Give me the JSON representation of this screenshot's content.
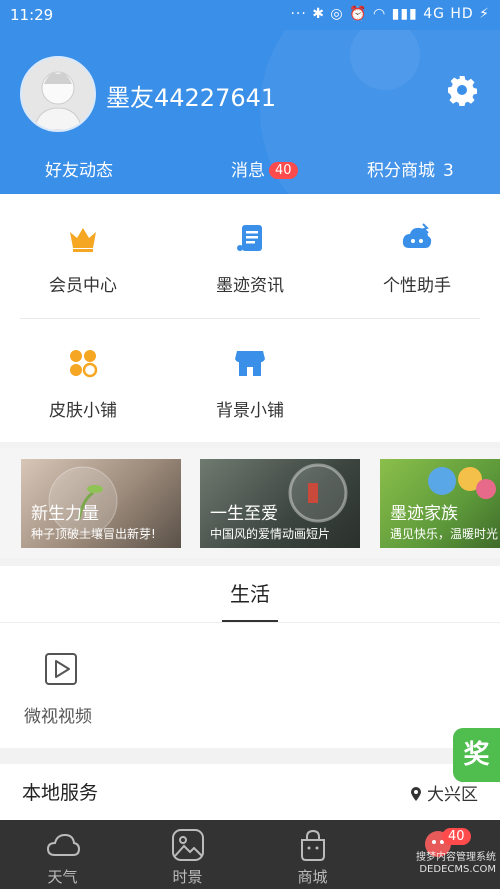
{
  "status": {
    "time": "11:29",
    "icons_text": "··· ✱ ◎ ⏰ ◠ ▮▮▮ 4G HD ⚡"
  },
  "profile": {
    "username": "墨友44227641"
  },
  "header_links": [
    {
      "label": "好友动态"
    },
    {
      "label": "消息",
      "badge": "40"
    },
    {
      "label": "积分商城",
      "count": "3"
    }
  ],
  "grid": [
    {
      "label": "会员中心",
      "icon": "crown-icon"
    },
    {
      "label": "墨迹资讯",
      "icon": "news-icon"
    },
    {
      "label": "个性助手",
      "icon": "assistant-icon"
    },
    {
      "label": "皮肤小铺",
      "icon": "skin-shop-icon"
    },
    {
      "label": "背景小铺",
      "icon": "store-icon"
    }
  ],
  "banners": [
    {
      "title": "新生力量",
      "subtitle": "种子顶破土壤冒出新芽!"
    },
    {
      "title": "一生至爱",
      "subtitle": "中国风的爱情动画短片"
    },
    {
      "title": "墨迹家族",
      "subtitle": "遇见快乐，温暖时光"
    }
  ],
  "life": {
    "tab": "生活",
    "items": [
      {
        "label": "微视视频",
        "icon": "video-play-icon"
      }
    ]
  },
  "local": {
    "title": "本地服务",
    "location": "大兴区"
  },
  "float_button": {
    "label": "奖"
  },
  "tabbar": {
    "items": [
      {
        "label": "天气",
        "icon": "cloud-icon"
      },
      {
        "label": "时景",
        "icon": "picture-icon"
      },
      {
        "label": "商城",
        "icon": "shopping-bag-icon"
      },
      {
        "label": "",
        "icon": "profile-icon"
      }
    ],
    "badge": "40"
  },
  "watermark": {
    "line1": "搜梦内容管理系统",
    "line2": "DEDECMS.COM"
  },
  "colors": {
    "primary": "#3a8fe8",
    "badge": "#ff4b4b",
    "accent_orange": "#f5a623",
    "float_green": "#4fbe4f",
    "tabbar": "#333333"
  }
}
